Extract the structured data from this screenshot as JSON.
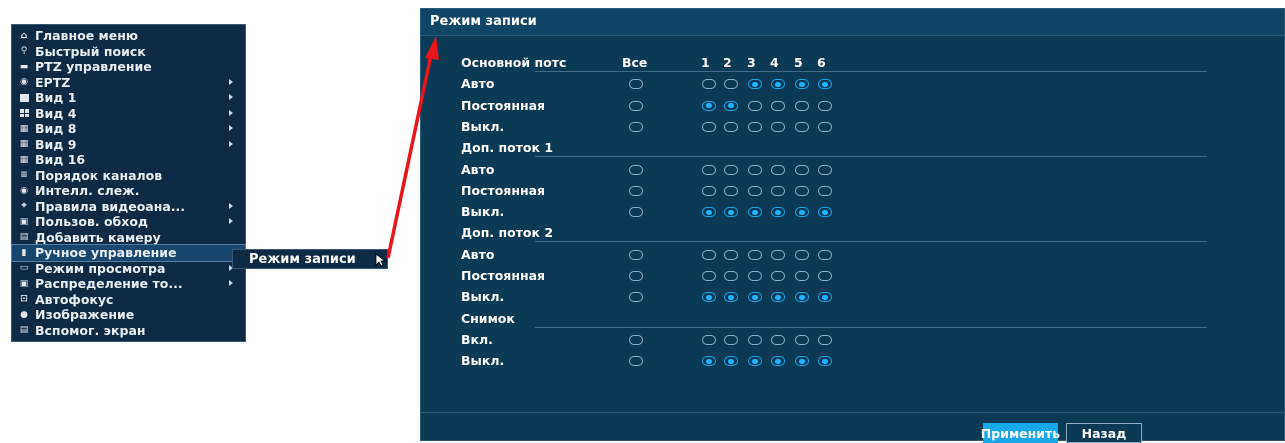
{
  "menu": {
    "items": [
      {
        "label": "Главное меню",
        "icon": "home-icon",
        "arrow": false
      },
      {
        "label": "Быстрый поиск",
        "icon": "search-icon",
        "arrow": false
      },
      {
        "label": "PTZ управление",
        "icon": "ptz-camera-icon",
        "arrow": false
      },
      {
        "label": "EPTZ",
        "icon": "eptz-icon",
        "arrow": true
      },
      {
        "label": "Вид 1",
        "icon": "view-1-icon",
        "arrow": true
      },
      {
        "label": "Вид 4",
        "icon": "view-4-icon",
        "arrow": true
      },
      {
        "label": "Вид 8",
        "icon": "view-8-icon",
        "arrow": true
      },
      {
        "label": "Вид 9",
        "icon": "view-9-icon",
        "arrow": true
      },
      {
        "label": "Вид 16",
        "icon": "view-16-icon",
        "arrow": false
      },
      {
        "label": "Порядок каналов",
        "icon": "channel-order-icon",
        "arrow": false
      },
      {
        "label": "Интелл. слеж.",
        "icon": "smart-tracking-icon",
        "arrow": false
      },
      {
        "label": "Правила видеоана...",
        "icon": "video-analytics-icon",
        "arrow": true
      },
      {
        "label": "Пользов. обход",
        "icon": "user-tour-icon",
        "arrow": true
      },
      {
        "label": "Добавить камеру",
        "icon": "add-camera-icon",
        "arrow": false
      },
      {
        "label": "Ручное управление",
        "icon": "manual-control-icon",
        "arrow": false,
        "selected": true
      },
      {
        "label": "Режим просмотра",
        "icon": "view-mode-icon",
        "arrow": true
      },
      {
        "label": "Распределение то...",
        "icon": "stream-distribution-icon",
        "arrow": true
      },
      {
        "label": "Автофокус",
        "icon": "autofocus-icon",
        "arrow": false
      },
      {
        "label": "Изображение",
        "icon": "image-icon",
        "arrow": false
      },
      {
        "label": "Вспомог. экран",
        "icon": "aux-screen-icon",
        "arrow": false
      }
    ]
  },
  "submenu": {
    "label": "Режим записи"
  },
  "dialog": {
    "title": "Режим записи",
    "header": {
      "stream_col": "Основной потс",
      "all_col": "Все",
      "channels": [
        "1",
        "2",
        "3",
        "4",
        "5",
        "6"
      ]
    },
    "sections": [
      {
        "name": "",
        "rows": [
          {
            "label": "Авто",
            "all": false,
            "values": [
              false,
              false,
              true,
              true,
              true,
              true
            ]
          },
          {
            "label": "Постоянная",
            "all": false,
            "values": [
              true,
              true,
              false,
              false,
              false,
              false
            ]
          },
          {
            "label": "Выкл.",
            "all": false,
            "values": [
              false,
              false,
              false,
              false,
              false,
              false
            ]
          }
        ]
      },
      {
        "name": "Доп. поток 1",
        "rows": [
          {
            "label": "Авто",
            "all": false,
            "values": [
              false,
              false,
              false,
              false,
              false,
              false
            ]
          },
          {
            "label": "Постоянная",
            "all": false,
            "values": [
              false,
              false,
              false,
              false,
              false,
              false
            ]
          },
          {
            "label": "Выкл.",
            "all": false,
            "values": [
              true,
              true,
              true,
              true,
              true,
              true
            ]
          }
        ]
      },
      {
        "name": "Доп. поток 2",
        "rows": [
          {
            "label": "Авто",
            "all": false,
            "values": [
              false,
              false,
              false,
              false,
              false,
              false
            ]
          },
          {
            "label": "Постоянная",
            "all": false,
            "values": [
              false,
              false,
              false,
              false,
              false,
              false
            ]
          },
          {
            "label": "Выкл.",
            "all": false,
            "values": [
              true,
              true,
              true,
              true,
              true,
              true
            ]
          }
        ]
      },
      {
        "name": "Снимок",
        "rows": [
          {
            "label": "Вкл.",
            "all": false,
            "values": [
              false,
              false,
              false,
              false,
              false,
              false
            ]
          },
          {
            "label": "Выкл.",
            "all": false,
            "values": [
              true,
              true,
              true,
              true,
              true,
              true
            ]
          }
        ]
      }
    ],
    "apply_label": "Применить",
    "back_label": "Назад"
  },
  "colors": {
    "accent": "#1fb3ff",
    "panel_bg": "#0b3a57",
    "menu_bg": "#0e2a44",
    "arrow": "#e8161b"
  }
}
